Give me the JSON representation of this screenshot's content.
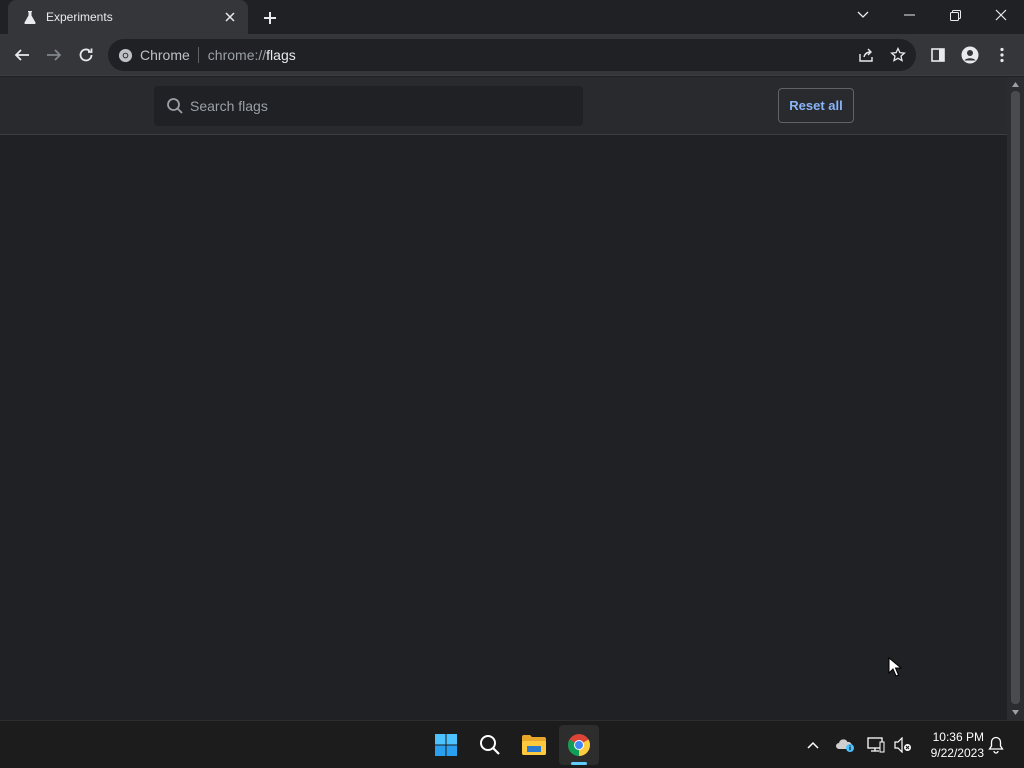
{
  "browser": {
    "tab": {
      "title": "Experiments"
    },
    "omnibox": {
      "chip_label": "Chrome",
      "url_scheme": "chrome://",
      "url_host": "flags"
    }
  },
  "flags_page": {
    "search": {
      "placeholder": "Search flags",
      "value": ""
    },
    "reset_label": "Reset all"
  },
  "taskbar": {
    "clock": {
      "time": "10:36 PM",
      "date": "9/22/2023"
    }
  },
  "colors": {
    "accent": "#8ab4f8",
    "page_bg": "#202124",
    "toolbar_bg": "#35363a",
    "taskbar_active_indicator": "#60cdff"
  }
}
